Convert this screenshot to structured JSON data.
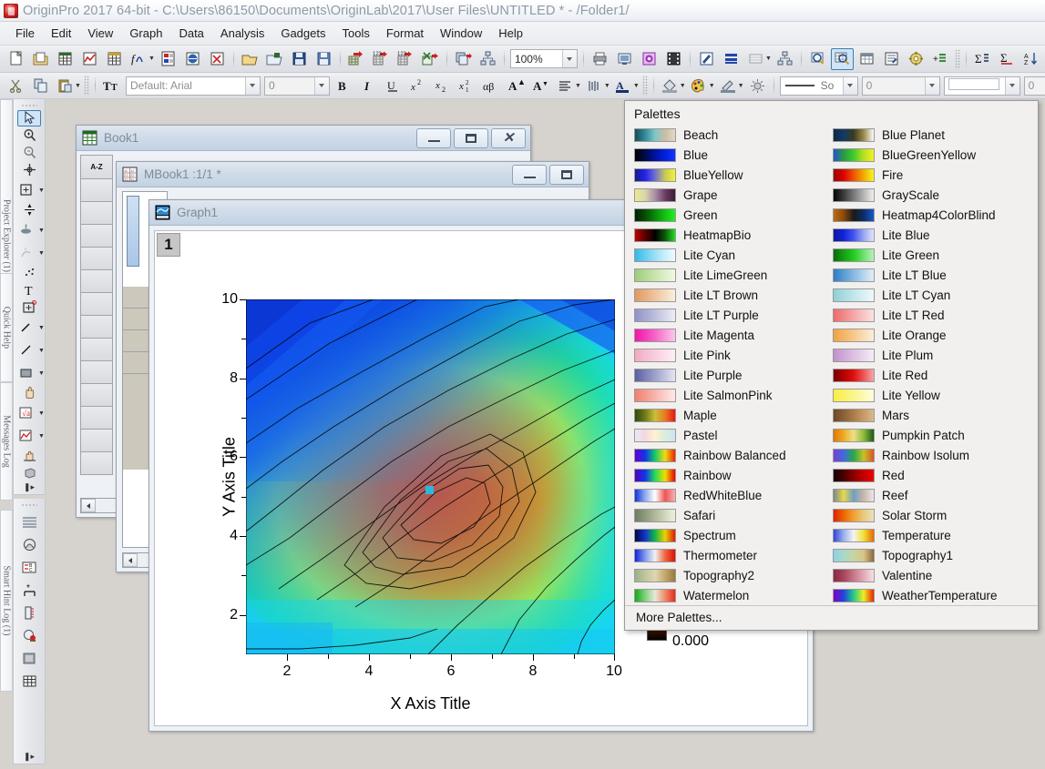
{
  "titlebar": {
    "text": "OriginPro 2017 64-bit - C:\\Users\\86150\\Documents\\OriginLab\\2017\\User Files\\UNTITLED * - /Folder1/",
    "icon": "origin-app-icon"
  },
  "menubar": {
    "items": [
      "File",
      "Edit",
      "View",
      "Graph",
      "Data",
      "Analysis",
      "Gadgets",
      "Tools",
      "Format",
      "Window",
      "Help"
    ]
  },
  "toolbar_standard": {
    "zoom_value": "100%",
    "buttons": [
      "new-project-icon",
      "new-folder-icon",
      "new-workbook-icon",
      "new-graph-icon",
      "new-matrix-icon",
      "new-function-plot-icon",
      "new-layout-icon",
      "new-notes-icon",
      "new-excel-icon",
      "open-icon",
      "open-excel-icon",
      "save-project-icon",
      "save-template-icon",
      "import-wizard-icon",
      "import-single-ascii-icon",
      "import-multiple-ascii-icon",
      "import-excel-icon",
      "duplicate-icon",
      "hierarchy-icon",
      "print-icon",
      "print-preview-icon",
      "copy-page-icon",
      "movie-icon",
      "annotation-icon",
      "layers-icon",
      "merge-graph-icon",
      "rescale-icon",
      "zoom-in-icon",
      "data-reader-icon",
      "worksheet-icon",
      "results-log-icon",
      "project-explorer-icon",
      "add-layer-icon",
      "statistics-icon",
      "integrate-icon",
      "sort-icon",
      "numeric-format-icon",
      "bar-chart-icon",
      "column-chart-icon",
      "multi-bar-icon",
      "filter-icon",
      "clear-filter-icon"
    ]
  },
  "toolbar_format": {
    "font_value": "Default: Arial",
    "size_value": "0",
    "line_style_value": "So",
    "line_width_value": "0",
    "fill_value": "0",
    "buttons": [
      "cut-icon",
      "copy-icon",
      "paste-icon",
      "font-icon",
      "bold-icon",
      "italic-icon",
      "underline-icon",
      "superscript-icon",
      "subscript-icon",
      "super-sub-icon",
      "greek-icon",
      "increase-font-icon",
      "decrease-font-icon",
      "align-icon",
      "hide-show-icon",
      "text-color-icon",
      "fill-color-icon",
      "palette-icon",
      "line-color-icon",
      "lightbulb-icon",
      "pattern-icon",
      "grid-icon",
      "axis-icon"
    ]
  },
  "left_toolbar_tools": {
    "buttons": [
      "pointer-icon",
      "zoom-in-tool-icon",
      "zoom-out-tool-icon",
      "screen-reader-icon",
      "data-reader-tool-icon",
      "data-selector-icon",
      "draw-data-icon",
      "regional-mask-icon",
      "scatter-icon",
      "text-tool-icon",
      "add-object-icon",
      "arrow-tool-icon",
      "line-tool-icon",
      "rectangle-tool-icon",
      "hand-tool-icon",
      "equation-tool-icon",
      "graph-tool-icon",
      "rotate-tool-icon",
      "3d-tool-icon"
    ]
  },
  "left_toolbar_graph": {
    "buttons": [
      "layer-contents-icon",
      "speed-mode-icon",
      "new-legend-icon",
      "add-text-icon",
      "color-scale-icon",
      "add-color-icon",
      "page-icon",
      "grid-table-icon"
    ]
  },
  "dock_panels": [
    {
      "name": "project-explorer",
      "label": "Project Explorer (1)"
    },
    {
      "name": "quick-help",
      "label": "Quick Help"
    },
    {
      "name": "messages-log",
      "label": "Messages Log"
    },
    {
      "name": "smart-hint-log",
      "label": "Smart Hint Log (1)"
    }
  ],
  "windows": {
    "book1": {
      "title": "Book1",
      "icon": "workbook-icon",
      "minimize_label": "—",
      "maximize_label": "□",
      "close_label": "✕",
      "column_header": "A-Z"
    },
    "mbook1": {
      "title": "MBook1 :1/1  *",
      "icon": "matrixbook-icon",
      "minimize_label": "—",
      "maximize_label": "□"
    },
    "graph1": {
      "title": "Graph1",
      "icon": "graph-window-icon",
      "layer_number": "1"
    }
  },
  "chart_data": {
    "type": "heatmap",
    "title": "",
    "xlabel": "X Axis Title",
    "ylabel": "Y Axis Title",
    "xlim": [
      1,
      10
    ],
    "ylim": [
      1,
      10
    ],
    "xticks": [
      "2",
      "4",
      "6",
      "8",
      "10"
    ],
    "xtick_values": [
      2,
      4,
      6,
      8,
      10
    ],
    "yticks": [
      "2",
      "4",
      "6",
      "8",
      "10"
    ],
    "ytick_values": [
      2,
      4,
      6,
      8,
      10
    ],
    "x_minor_ticks": [
      3,
      5,
      7,
      9
    ],
    "y_minor_ticks": [
      3,
      5,
      7,
      9
    ],
    "colormap": "Rainbow",
    "contour_lines": true,
    "grid": false,
    "legend": "none",
    "marker": {
      "x": 5.4,
      "y": 5.4,
      "color": "#2bb8dd",
      "shape": "square"
    },
    "colorbar_label": "0.000",
    "peak": {
      "x": 6.2,
      "y": 5.5,
      "value": "max"
    },
    "z_description": "Single broad peak centred near x=6, y=5.5 decaying toward the upper-left (blue) corner"
  },
  "palette_popup": {
    "title": "Palettes",
    "more_label": "More Palettes...",
    "left_column": [
      {
        "label": "Beach",
        "colors": [
          "#1b4a57",
          "#2f8c9a",
          "#7fc6c9",
          "#cbbda3",
          "#e2d9c3"
        ]
      },
      {
        "label": "Blue",
        "colors": [
          "#000000",
          "#000a4a",
          "#0011a0",
          "#0022dd",
          "#1133ff"
        ]
      },
      {
        "label": "BlueYellow",
        "colors": [
          "#1a1a88",
          "#2222ee",
          "#6f6fd0",
          "#c8c858",
          "#f2f23a"
        ]
      },
      {
        "label": "Grape",
        "colors": [
          "#e8ea92",
          "#d9d6a8",
          "#a98ea6",
          "#6d3d66",
          "#3a1a33"
        ]
      },
      {
        "label": "Green",
        "colors": [
          "#002200",
          "#064d06",
          "#0a8a0a",
          "#12c312",
          "#22ee22"
        ]
      },
      {
        "label": "HeatmapBio",
        "colors": [
          "#c00000",
          "#5a0000",
          "#000000",
          "#0a5a0a",
          "#22dd22"
        ]
      },
      {
        "label": "Lite Cyan",
        "colors": [
          "#33b9e8",
          "#66cdee",
          "#9bdff4",
          "#c9effa",
          "#eefaff"
        ]
      },
      {
        "label": "Lite LimeGreen",
        "colors": [
          "#9ccc7a",
          "#b3d894",
          "#c8e4ae",
          "#dcefca",
          "#f0f8e4"
        ]
      },
      {
        "label": "Lite LT Brown",
        "colors": [
          "#e09a62",
          "#e8ae7d",
          "#efc49c",
          "#f5d9bd",
          "#fbeedd"
        ]
      },
      {
        "label": "Lite LT Purple",
        "colors": [
          "#8f92c4",
          "#a5a8d0",
          "#bcbedd",
          "#d4d5e9",
          "#ecedf6"
        ]
      },
      {
        "label": "Lite Magenta",
        "colors": [
          "#f018a8",
          "#f43bb8",
          "#f765c7",
          "#fa96d8",
          "#fdc8ea"
        ]
      },
      {
        "label": "Lite Pink",
        "colors": [
          "#f2a9c0",
          "#f5bccf",
          "#f8cddd",
          "#fbdfe9",
          "#fdeff5"
        ]
      },
      {
        "label": "Lite Purple",
        "colors": [
          "#5a5f9e",
          "#7b80b6",
          "#9da1cc",
          "#c0c3e0",
          "#e5e6f3"
        ]
      },
      {
        "label": "Lite SalmonPink",
        "colors": [
          "#f08070",
          "#f49a8d",
          "#f7b5ac",
          "#fad0ca",
          "#fdeae7"
        ]
      },
      {
        "label": "Maple",
        "colors": [
          "#2f4a12",
          "#6f7a16",
          "#c9c03a",
          "#e87b22",
          "#ee1111"
        ]
      },
      {
        "label": "Pastel",
        "colors": [
          "#e8e8f4",
          "#f4d8e0",
          "#fdf2cf",
          "#d8eedd",
          "#cfe4f2"
        ]
      },
      {
        "label": "Rainbow Balanced",
        "colors": [
          "#6600cc",
          "#1133ee",
          "#11cc66",
          "#eedd11",
          "#ee2200"
        ]
      },
      {
        "label": "Rainbow",
        "colors": [
          "#5500bb",
          "#1133ee",
          "#22dd55",
          "#eedd00",
          "#ee0000"
        ]
      },
      {
        "label": "RedWhiteBlue",
        "colors": [
          "#1133dd",
          "#8fa9ee",
          "#ffffff",
          "#ee5555",
          "#f5b0b0"
        ]
      },
      {
        "label": "Safari",
        "colors": [
          "#6e7d63",
          "#8d9a7c",
          "#b0b89a",
          "#d1d6bb",
          "#eef0dd"
        ]
      },
      {
        "label": "Spectrum",
        "colors": [
          "#060640",
          "#1133cc",
          "#12b844",
          "#ecd000",
          "#dd1a00"
        ]
      },
      {
        "label": "Thermometer",
        "colors": [
          "#1122dd",
          "#7f99ee",
          "#f2f2f2",
          "#ee6644",
          "#dd1100"
        ]
      },
      {
        "label": "Topography2",
        "colors": [
          "#9ab08a",
          "#c0c49c",
          "#ddd6b4",
          "#c4a86a",
          "#9a7a3c"
        ]
      },
      {
        "label": "Watermelon",
        "colors": [
          "#14aa14",
          "#7fd07f",
          "#e8e8d8",
          "#ef8a6a",
          "#e82a1a"
        ]
      }
    ],
    "right_column": [
      {
        "label": "Blue Planet",
        "colors": [
          "#0d2744",
          "#123a66",
          "#3a3a20",
          "#9a8a4a",
          "#fdfdfd"
        ]
      },
      {
        "label": "BlueGreenYellow",
        "colors": [
          "#2255cc",
          "#2a9a44",
          "#3fcc2a",
          "#b8e022",
          "#f2f222"
        ]
      },
      {
        "label": "Fire",
        "colors": [
          "#9a0000",
          "#dd0000",
          "#ee5500",
          "#f2aa00",
          "#f7f722"
        ]
      },
      {
        "label": "GrayScale",
        "colors": [
          "#050505",
          "#3a3a3a",
          "#787878",
          "#b4b4b4",
          "#f0f0f0"
        ]
      },
      {
        "label": "Heatmap4ColorBlind",
        "colors": [
          "#c06a10",
          "#8a4a08",
          "#1a1a1a",
          "#0d2d66",
          "#1a55cc"
        ]
      },
      {
        "label": "Lite Blue",
        "colors": [
          "#0a1a9a",
          "#1122dd",
          "#4455ee",
          "#9aa6f2",
          "#e2e6fb"
        ]
      },
      {
        "label": "Lite Green",
        "colors": [
          "#0a6a0a",
          "#14a014",
          "#22cc22",
          "#6fe06f",
          "#b8f2b8"
        ]
      },
      {
        "label": "Lite LT Blue",
        "colors": [
          "#2f7dc4",
          "#5a9bd4",
          "#88b8e2",
          "#b5d4ee",
          "#e1eef8"
        ]
      },
      {
        "label": "Lite LT Cyan",
        "colors": [
          "#8fd0d8",
          "#a8dbe1",
          "#c0e6ea",
          "#d8f0f3",
          "#eff9fa"
        ]
      },
      {
        "label": "Lite LT Red",
        "colors": [
          "#ee6a6a",
          "#f28888",
          "#f5a6a6",
          "#f9c4c4",
          "#fce2e2"
        ]
      },
      {
        "label": "Lite Orange",
        "colors": [
          "#f0a344",
          "#f4b566",
          "#f7c88c",
          "#fadbb4",
          "#fdeedd"
        ]
      },
      {
        "label": "Lite Plum",
        "colors": [
          "#c292cc",
          "#cfa8d6",
          "#dcbfe1",
          "#e9d6ec",
          "#f6edf7"
        ]
      },
      {
        "label": "Lite Red",
        "colors": [
          "#7a0000",
          "#b40000",
          "#e01010",
          "#ee5555",
          "#f8a8a8"
        ]
      },
      {
        "label": "Lite Yellow",
        "colors": [
          "#f7ee44",
          "#f9f166",
          "#fbf58c",
          "#fdf9b4",
          "#fefdde"
        ]
      },
      {
        "label": "Mars",
        "colors": [
          "#6a4a2a",
          "#8a6238",
          "#ab7c48",
          "#c79a66",
          "#d9b98c"
        ]
      },
      {
        "label": "Pumpkin Patch",
        "colors": [
          "#e07800",
          "#eeaa22",
          "#eee088",
          "#8aba3a",
          "#1a5a1a"
        ]
      },
      {
        "label": "Rainbow Isolum",
        "colors": [
          "#7a3fd0",
          "#3f6ae0",
          "#2aa84a",
          "#c2c22a",
          "#dd5522"
        ]
      },
      {
        "label": "Red",
        "colors": [
          "#150000",
          "#4a0000",
          "#8a0000",
          "#c40000",
          "#ee0000"
        ]
      },
      {
        "label": "Reef",
        "colors": [
          "#7a8a8a",
          "#e8d84a",
          "#6f9fc4",
          "#c8b8a8",
          "#eee4ee"
        ]
      },
      {
        "label": "Solar Storm",
        "colors": [
          "#dd2200",
          "#ee6600",
          "#f2a030",
          "#e8c880",
          "#ece0c0"
        ]
      },
      {
        "label": "Temperature",
        "colors": [
          "#3344dd",
          "#9ab0ee",
          "#f4f4f4",
          "#f2e033",
          "#ee6600"
        ]
      },
      {
        "label": "Topography1",
        "colors": [
          "#8fd0e8",
          "#a8d8c8",
          "#c8d4a0",
          "#d8c488",
          "#8a6a3a"
        ]
      },
      {
        "label": "Valentine",
        "colors": [
          "#8a2a44",
          "#a8445c",
          "#c87788",
          "#e2aab6",
          "#f6e0e6"
        ]
      },
      {
        "label": "WeatherTemperature",
        "colors": [
          "#8000c0",
          "#2244dd",
          "#22cc88",
          "#eeee22",
          "#ee2200"
        ]
      }
    ]
  }
}
